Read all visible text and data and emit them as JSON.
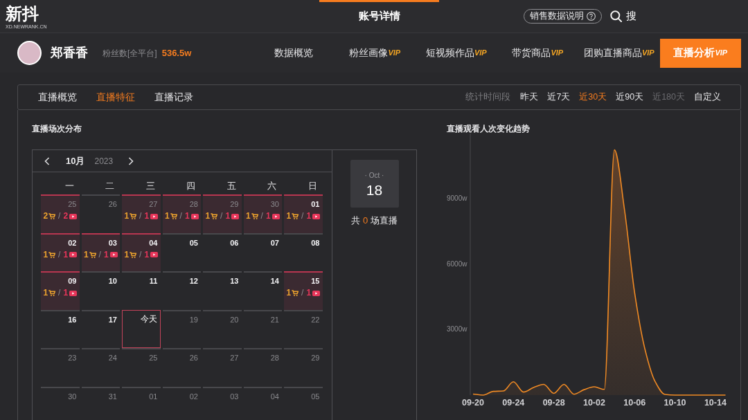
{
  "header": {
    "logo": "新抖",
    "logo_subtitle": "XD.NEWRANK.CN",
    "title": "账号详情",
    "help_button": "销售数据说明",
    "search": "搜"
  },
  "profile": {
    "name": "郑香香",
    "followers_label": "粉丝数[全平台]",
    "followers": "536.5w"
  },
  "nav_tabs": [
    {
      "label": "数据概览",
      "selected": false
    },
    {
      "label": "粉丝画像",
      "badge": "VIP",
      "selected": false
    },
    {
      "label": "短视频作品",
      "badge": "VIP",
      "selected": false
    },
    {
      "label": "带货商品",
      "badge": "VIP",
      "selected": false
    },
    {
      "label": "团购直播商品",
      "badge": "VIP",
      "selected": false
    },
    {
      "label": "直播分析",
      "badge": "VIP",
      "selected": true
    }
  ],
  "sub_tabs": [
    {
      "label": "直播概览",
      "selected": false
    },
    {
      "label": "直播特征",
      "selected": true
    },
    {
      "label": "直播记录",
      "selected": false
    }
  ],
  "period": {
    "label": "统计时间段",
    "options": [
      {
        "label": "昨天",
        "selected": false,
        "disabled": false
      },
      {
        "label": "近7天",
        "selected": false,
        "disabled": false
      },
      {
        "label": "近30天",
        "selected": true,
        "disabled": false
      },
      {
        "label": "近90天",
        "selected": false,
        "disabled": false
      },
      {
        "label": "近180天",
        "selected": false,
        "disabled": true
      },
      {
        "label": "自定义",
        "selected": false,
        "disabled": false
      }
    ]
  },
  "calendar": {
    "title": "直播场次分布",
    "month": "10月",
    "year": "2023",
    "weekdays": [
      "一",
      "二",
      "三",
      "四",
      "五",
      "六",
      "日"
    ],
    "weeks": [
      [
        {
          "label": "25",
          "kind": "muted",
          "goods": "2",
          "sep": "/",
          "streams": "2"
        },
        {
          "label": "26",
          "kind": "muted"
        },
        {
          "label": "27",
          "kind": "muted",
          "goods": "1",
          "sep": "/",
          "streams": "1"
        },
        {
          "label": "28",
          "kind": "muted",
          "goods": "1",
          "sep": "/",
          "streams": "1"
        },
        {
          "label": "29",
          "kind": "muted",
          "goods": "1",
          "sep": "/",
          "streams": "1"
        },
        {
          "label": "30",
          "kind": "muted",
          "goods": "1",
          "sep": "/",
          "streams": "1"
        },
        {
          "label": "01",
          "kind": "current",
          "goods": "1",
          "sep": "/",
          "streams": "1"
        }
      ],
      [
        {
          "label": "02",
          "kind": "current",
          "goods": "1",
          "sep": "/",
          "streams": "1"
        },
        {
          "label": "03",
          "kind": "current",
          "goods": "1",
          "sep": "/",
          "streams": "1"
        },
        {
          "label": "04",
          "kind": "current",
          "goods": "1",
          "sep": "/",
          "streams": "1"
        },
        {
          "label": "05",
          "kind": "current"
        },
        {
          "label": "06",
          "kind": "current"
        },
        {
          "label": "07",
          "kind": "current"
        },
        {
          "label": "08",
          "kind": "current"
        }
      ],
      [
        {
          "label": "09",
          "kind": "current",
          "goods": "1",
          "sep": "/",
          "streams": "1"
        },
        {
          "label": "10",
          "kind": "current"
        },
        {
          "label": "11",
          "kind": "current"
        },
        {
          "label": "12",
          "kind": "current"
        },
        {
          "label": "13",
          "kind": "current"
        },
        {
          "label": "14",
          "kind": "current"
        },
        {
          "label": "15",
          "kind": "current",
          "goods": "1",
          "sep": "/",
          "streams": "1"
        }
      ],
      [
        {
          "label": "16",
          "kind": "current"
        },
        {
          "label": "17",
          "kind": "current"
        },
        {
          "label": "今天",
          "kind": "today"
        },
        {
          "label": "19",
          "kind": "muted"
        },
        {
          "label": "20",
          "kind": "muted"
        },
        {
          "label": "21",
          "kind": "muted"
        },
        {
          "label": "22",
          "kind": "muted"
        }
      ],
      [
        {
          "label": "23",
          "kind": "muted"
        },
        {
          "label": "24",
          "kind": "muted"
        },
        {
          "label": "25",
          "kind": "muted"
        },
        {
          "label": "26",
          "kind": "muted"
        },
        {
          "label": "27",
          "kind": "muted"
        },
        {
          "label": "28",
          "kind": "muted"
        },
        {
          "label": "29",
          "kind": "muted"
        }
      ],
      [
        {
          "label": "30",
          "kind": "muted"
        },
        {
          "label": "31",
          "kind": "muted"
        },
        {
          "label": "01",
          "kind": "muted"
        },
        {
          "label": "02",
          "kind": "muted"
        },
        {
          "label": "03",
          "kind": "muted"
        },
        {
          "label": "04",
          "kind": "muted"
        },
        {
          "label": "05",
          "kind": "muted"
        }
      ]
    ],
    "selected_date": {
      "month": "· Oct ·",
      "day": "18",
      "summary_prefix": "共",
      "count": "0",
      "summary_suffix": "场直播"
    }
  },
  "trend": {
    "chart_data": {
      "type": "area",
      "title": "直播观看人次变化趋势",
      "categories": [
        "09-20",
        null,
        null,
        null,
        "09-24",
        null,
        null,
        null,
        "09-28",
        null,
        null,
        null,
        "10-02",
        null,
        null,
        null,
        "10-06",
        null,
        null,
        null,
        "10-10",
        null,
        null,
        null,
        "10-14",
        null
      ],
      "values": [
        50,
        0,
        170,
        190,
        610,
        140,
        350,
        490,
        80,
        490,
        40,
        250,
        380,
        260,
        11250,
        8500,
        4700,
        2150,
        650,
        30,
        0,
        0,
        0,
        0,
        0,
        0
      ],
      "ylim": [
        0,
        12000
      ],
      "yticks": [
        {
          "value": 3000,
          "label": "3000w"
        },
        {
          "value": 6000,
          "label": "6000w"
        },
        {
          "value": 9000,
          "label": "9000w"
        }
      ]
    }
  }
}
